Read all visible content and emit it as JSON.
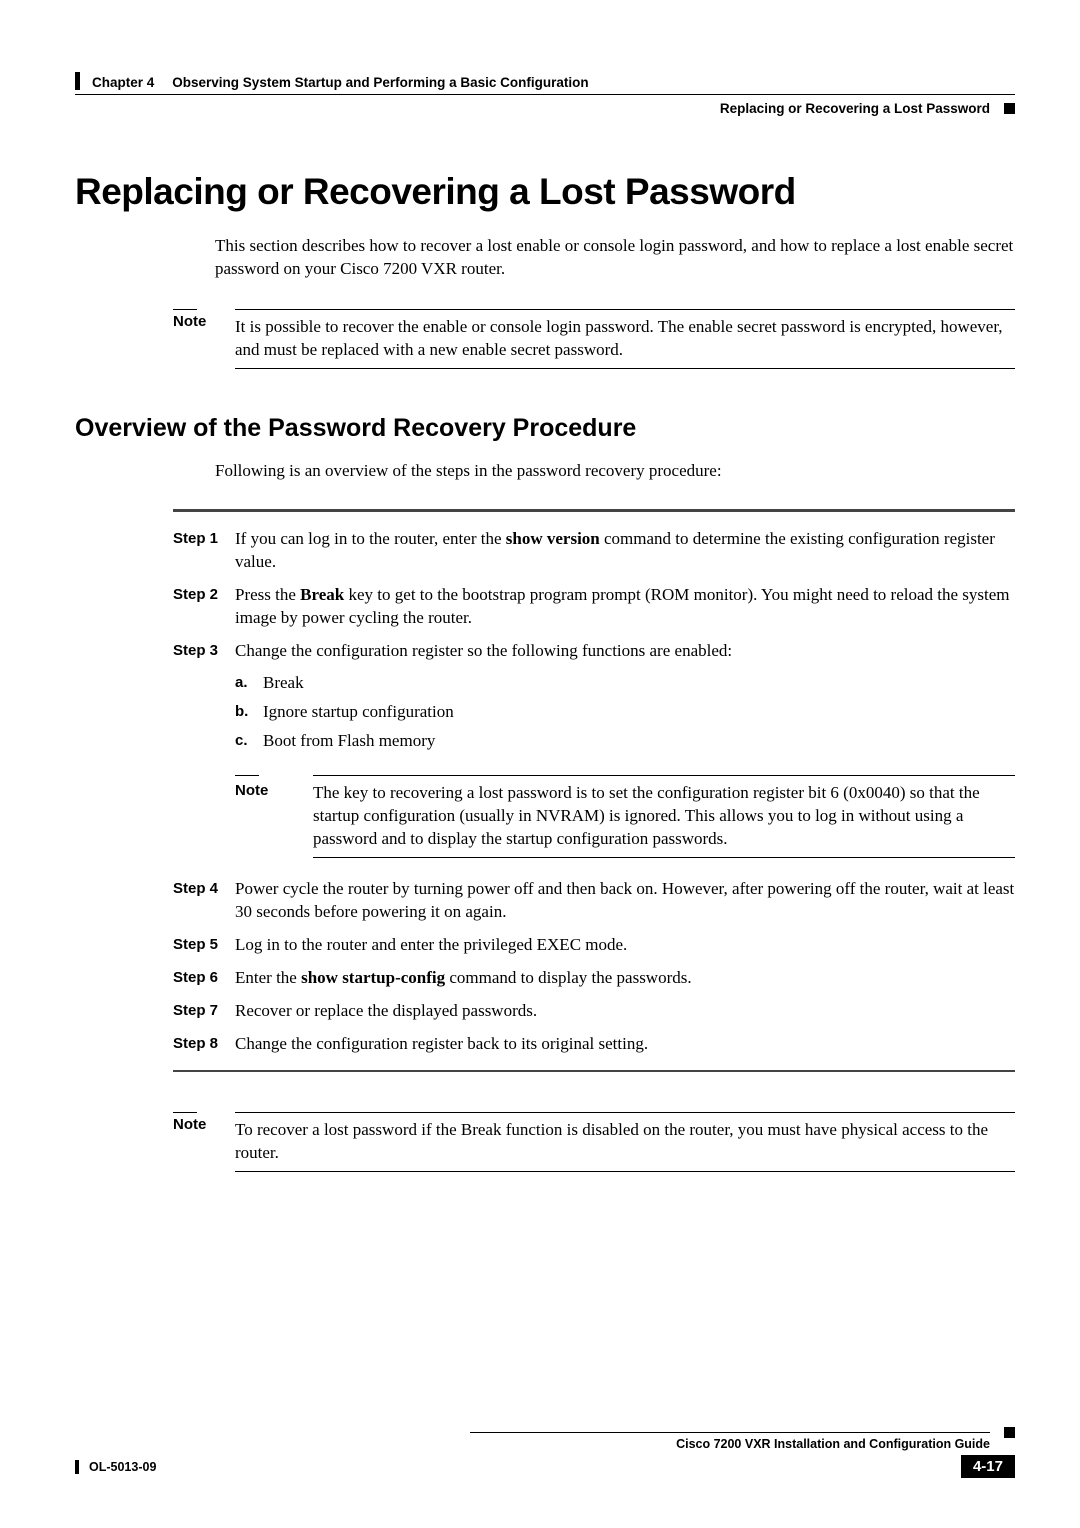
{
  "header": {
    "chapter": "Chapter 4",
    "chapter_title": "Observing System Startup and Performing a Basic Configuration",
    "section": "Replacing or Recovering a Lost Password"
  },
  "main": {
    "title": "Replacing or Recovering a Lost Password",
    "intro": "This section describes how to recover a lost enable or console login password, and how to replace a lost enable secret password on your Cisco 7200 VXR router."
  },
  "note1": {
    "label": "Note",
    "text": "It is possible to recover the enable or console login password. The enable secret password is encrypted, however, and must be replaced with a new enable secret password."
  },
  "overview": {
    "title": "Overview of the Password Recovery Procedure",
    "lead": "Following is an overview of the steps in the password recovery procedure:"
  },
  "steps": [
    {
      "label": "Step 1",
      "pre": "If you can log in to the router, enter the ",
      "bold": "show version",
      "post": " command to determine the existing configuration register value."
    },
    {
      "label": "Step 2",
      "pre": "Press the ",
      "bold": "Break",
      "post": " key to get to the bootstrap program prompt (ROM monitor). You might need to reload the system image by power cycling the router."
    },
    {
      "label": "Step 3",
      "pre": "Change the configuration register so the following functions are enabled:",
      "bold": "",
      "post": "",
      "sub": [
        {
          "letter": "a.",
          "text": "Break"
        },
        {
          "letter": "b.",
          "text": "Ignore startup configuration"
        },
        {
          "letter": "c.",
          "text": "Boot from Flash memory"
        }
      ],
      "note": {
        "label": "Note",
        "text": "The key to recovering a lost password is to set the configuration register bit 6 (0x0040) so that the startup configuration (usually in NVRAM) is ignored. This allows you to log in without using a password and to display the startup configuration passwords."
      }
    },
    {
      "label": "Step 4",
      "pre": "Power cycle the router by turning power off and then back on. However, after powering off the router, wait at least 30 seconds before powering it on again.",
      "bold": "",
      "post": ""
    },
    {
      "label": "Step 5",
      "pre": "Log in to the router and enter the privileged EXEC mode.",
      "bold": "",
      "post": ""
    },
    {
      "label": "Step 6",
      "pre": "Enter the ",
      "bold": "show startup-config",
      "post": " command to display the passwords."
    },
    {
      "label": "Step 7",
      "pre": "Recover or replace the displayed passwords.",
      "bold": "",
      "post": ""
    },
    {
      "label": "Step 8",
      "pre": "Change the configuration register back to its original setting.",
      "bold": "",
      "post": ""
    }
  ],
  "note2": {
    "label": "Note",
    "text": "To recover a lost password if the Break function is disabled on the router, you must have physical access to the router."
  },
  "footer": {
    "guide": "Cisco 7200 VXR Installation and Configuration Guide",
    "doc_id": "OL-5013-09",
    "page": "4-17"
  }
}
